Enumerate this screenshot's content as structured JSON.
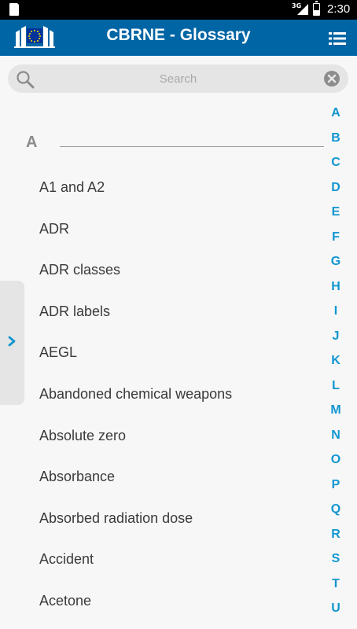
{
  "status_bar": {
    "network": "3G",
    "time": "2:30"
  },
  "app_bar": {
    "title": "CBRNE - Glossary",
    "logo_icon": "eu-commission-logo-icon",
    "menu_icon": "list-menu-icon"
  },
  "search": {
    "placeholder": "Search",
    "value": ""
  },
  "section": {
    "letter": "A"
  },
  "terms": [
    "A1 and A2",
    "ADR",
    "ADR classes",
    "ADR labels",
    "AEGL",
    "Abandoned chemical weapons",
    "Absolute zero",
    "Absorbance",
    "Absorbed radiation dose",
    "Accident",
    "Acetone"
  ],
  "alphabet": [
    "A",
    "B",
    "C",
    "D",
    "E",
    "F",
    "G",
    "H",
    "I",
    "J",
    "K",
    "L",
    "M",
    "N",
    "O",
    "P",
    "Q",
    "R",
    "S",
    "T",
    "U"
  ],
  "colors": {
    "app_bar": "#0065a4",
    "accent": "#1296d0",
    "background": "#f7f7f7"
  }
}
